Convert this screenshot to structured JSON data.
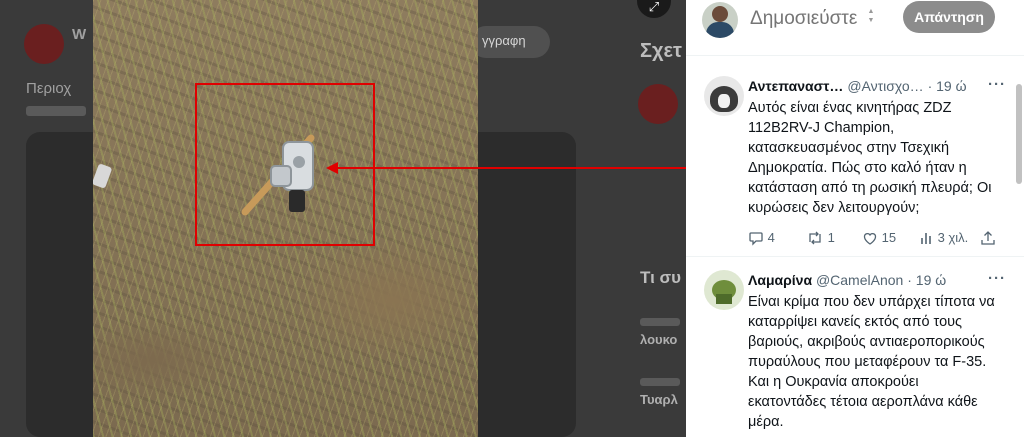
{
  "page_title_hint": "",
  "background": {
    "left_texts": [
      {
        "name": "ghost-user-name",
        "text": "W"
      },
      {
        "name": "ghost-follow-label",
        "text": "γγραφη"
      },
      {
        "name": "ghost-line-1",
        "text": "Περιοχ"
      },
      {
        "name": "ghost-side-heading",
        "text": "Σχετ"
      },
      {
        "name": "ghost-trends-heading",
        "text": "Τι συ"
      },
      {
        "name": "ghost-trend-1",
        "text": "λουκο"
      },
      {
        "name": "ghost-trend-2",
        "text": "Τυαρλ"
      }
    ],
    "expand_icon": "arrows-expand-icon"
  },
  "composer": {
    "placeholder": "Δημοσιεύστε",
    "reply_label": "Απάντηση"
  },
  "tweets": [
    {
      "name": "Αντεπαναστ…",
      "handle": "@Αντισχο…",
      "dot": "·",
      "time": "19 ώ",
      "text": "Αυτός είναι ένας κινητήρας ZDZ 112B2RV-J Champion, κατασκευασμένος στην Τσεχική Δημοκρατία. Πώς στο καλό ήταν η κατάσταση από τη ρωσική πλευρά; Οι κυρώσεις δεν λειτουργούν;",
      "replies": "4",
      "reposts": "1",
      "likes": "15",
      "views": "3 χιλ."
    },
    {
      "name": "Λαμαρίνα",
      "handle": "@CamelAnon",
      "dot": "·",
      "time": "19 ώ",
      "text": "Είναι κρίμα που δεν υπάρχει τίποτα να καταρρίψει κανείς εκτός από τους βαριούς, ακριβούς αντιαεροπορικούς πυραύλους που μεταφέρουν τα F-35. Και η Ουκρανία αποκρούει εκατοντάδες τέτοια αεροπλάνα κάθε μέρα."
    }
  ],
  "icons": {
    "more": "more-dots-icon",
    "reply": "reply-bubble-icon",
    "repost": "repost-icon",
    "like": "heart-icon",
    "views": "views-chart-icon",
    "share": "share-icon"
  },
  "colors": {
    "annotation_red": "#e00000",
    "reply_button_bg": "#8c8c8c",
    "secondary_text": "#536471"
  }
}
